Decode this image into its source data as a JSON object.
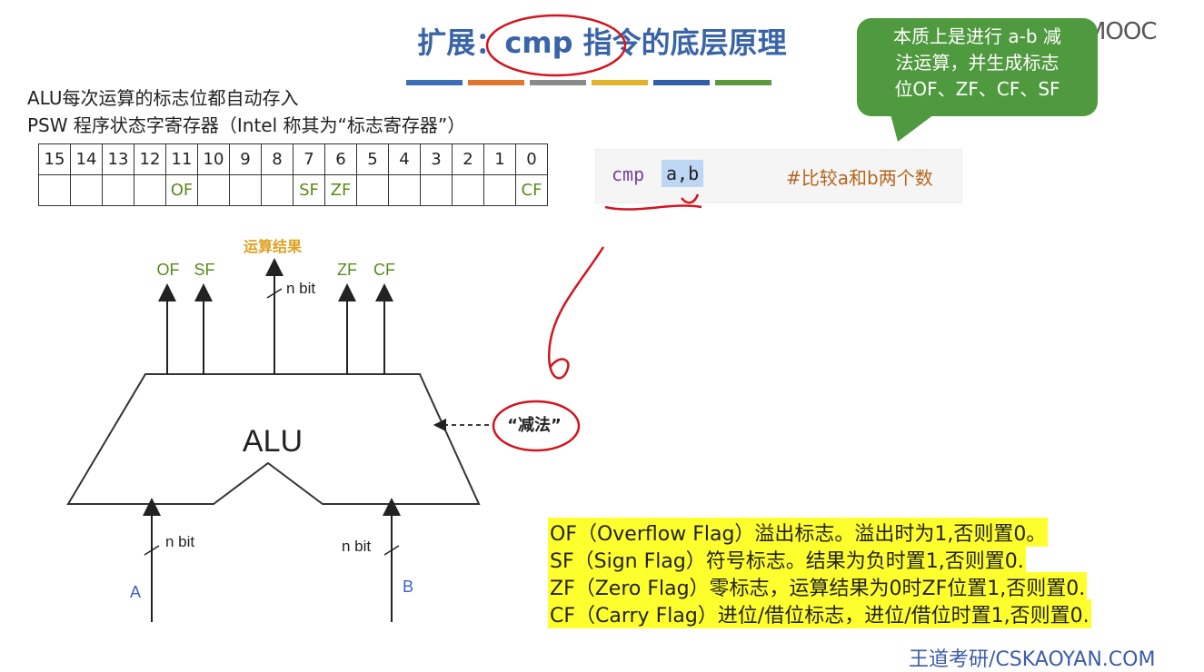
{
  "slide": {
    "title_prefix": "扩展：",
    "title_cmp": "cmp",
    "title_suffix": " 指令的底层原理",
    "title_bar_colors": [
      "#3b6fb5",
      "#e0762b",
      "#8a8a8a",
      "#e2b22a",
      "#2f5fa8",
      "#5a9a3a"
    ],
    "description_line1": "ALU每次运算的标志位都自动存入",
    "description_line2": "PSW 程序状态字寄存器（Intel 称其为“标志寄存器”）",
    "watermark_logo": "中国大学MOOC",
    "footer_watermark": "王道考研/CSKAOYAN.COM"
  },
  "psw_table": {
    "bits": [
      "15",
      "14",
      "13",
      "12",
      "11",
      "10",
      "9",
      "8",
      "7",
      "6",
      "5",
      "4",
      "3",
      "2",
      "1",
      "0"
    ],
    "flags": [
      "",
      "",
      "",
      "",
      "OF",
      "",
      "",
      "",
      "SF",
      "ZF",
      "",
      "",
      "",
      "",
      "",
      "CF"
    ]
  },
  "callout": {
    "text_line1": "本质上是进行 a-b 减",
    "text_line2": "法运算，并生成标志",
    "text_line3": "位OF、ZF、CF、SF"
  },
  "code": {
    "opcode": "cmp",
    "operands": "a,b",
    "comment": "#比较a和b两个数"
  },
  "alu_diagram": {
    "alu_label": "ALU",
    "result_label": "运算结果",
    "out_flags": [
      "OF",
      "SF",
      "ZF",
      "CF"
    ],
    "nbit_top": "n bit",
    "nbit_left": "n bit",
    "nbit_right": "n bit",
    "input_a": "A",
    "input_b": "B",
    "operation_label": "“减法”"
  },
  "flag_descriptions": [
    "OF（Overflow Flag）溢出标志。溢出时为1,否则置0。",
    "SF（Sign Flag）符号标志。结果为负时置1,否则置0.",
    "ZF（Zero Flag）零标志，运算结果为0时ZF位置1,否则置0.",
    "CF（Carry Flag）进位/借位标志，进位/借位时置1,否则置0."
  ],
  "colors": {
    "title": "#3a64a8",
    "flag_green": "#5a8a1a",
    "callout_bg": "#4f9a3e",
    "result_label": "#e0a020",
    "input_label": "#3a5fc8",
    "annotation_red": "#d4141c",
    "highlight": "#ffff2e"
  }
}
